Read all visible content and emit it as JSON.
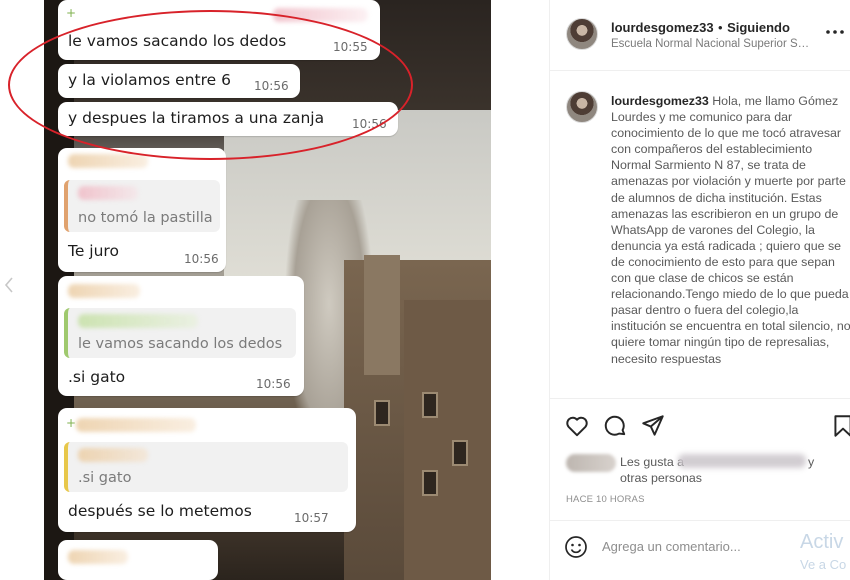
{
  "chat": {
    "messages": [
      {
        "text": "le vamos sacando los dedos",
        "time": "10:55"
      },
      {
        "text": "y la violamos entre 6",
        "time": "10:56"
      },
      {
        "text": "y despues la tiramos a una zanja",
        "time": "10:56"
      },
      {
        "quote": "no tomó la pastilla",
        "text": "Te juro",
        "time": "10:56"
      },
      {
        "quote": "le vamos sacando los dedos",
        "text": ".si gato",
        "time": "10:56"
      },
      {
        "quote": ".si gato",
        "text": "después se lo metemos",
        "time": "10:57"
      }
    ]
  },
  "post": {
    "username": "lourdesgomez33",
    "follow_status": "Siguiendo",
    "separator": "•",
    "location": "Escuela Normal Nacional Superior Sar...",
    "more_icon": "more-options-icon",
    "caption_user": "lourdesgomez33",
    "caption_text": "Hola, me llamo Gómez Lourdes y me comunico para dar conocimiento de lo que me tocó atravesar con compañeros del establecimiento Normal Sarmiento N 87, se trata de amenazas por violación y muerte por parte de alumnos de dicha institución. Estas amenazas las escribieron en un grupo de WhatsApp de varones del Colegio, la denuncia ya está radicada ; quiero que se de conocimiento de esto para que sepan con que clase de chicos se están relacionando.Tengo miedo de lo que pueda pasar dentro o fuera del colegio,la institución se encuentra en total silencio, no quiere tomar ningún tipo de represalias, necesito respuestas",
    "likes_prefix": "Les gusta a",
    "likes_suffix": "y",
    "likes_others": "otras personas",
    "time_ago": "HACE 10 HORAS",
    "comment_placeholder": "Agrega un comentario...",
    "watermark_line1": "Activ",
    "watermark_line2": "Ve a Co"
  },
  "icons": {
    "like": "heart-icon",
    "comment": "comment-icon",
    "share": "send-icon",
    "save": "bookmark-icon",
    "emoji": "emoji-icon",
    "prev": "chevron-left-icon"
  },
  "colors": {
    "annotation": "#d8222a",
    "text": "#262626",
    "muted": "#8e8e8e"
  }
}
